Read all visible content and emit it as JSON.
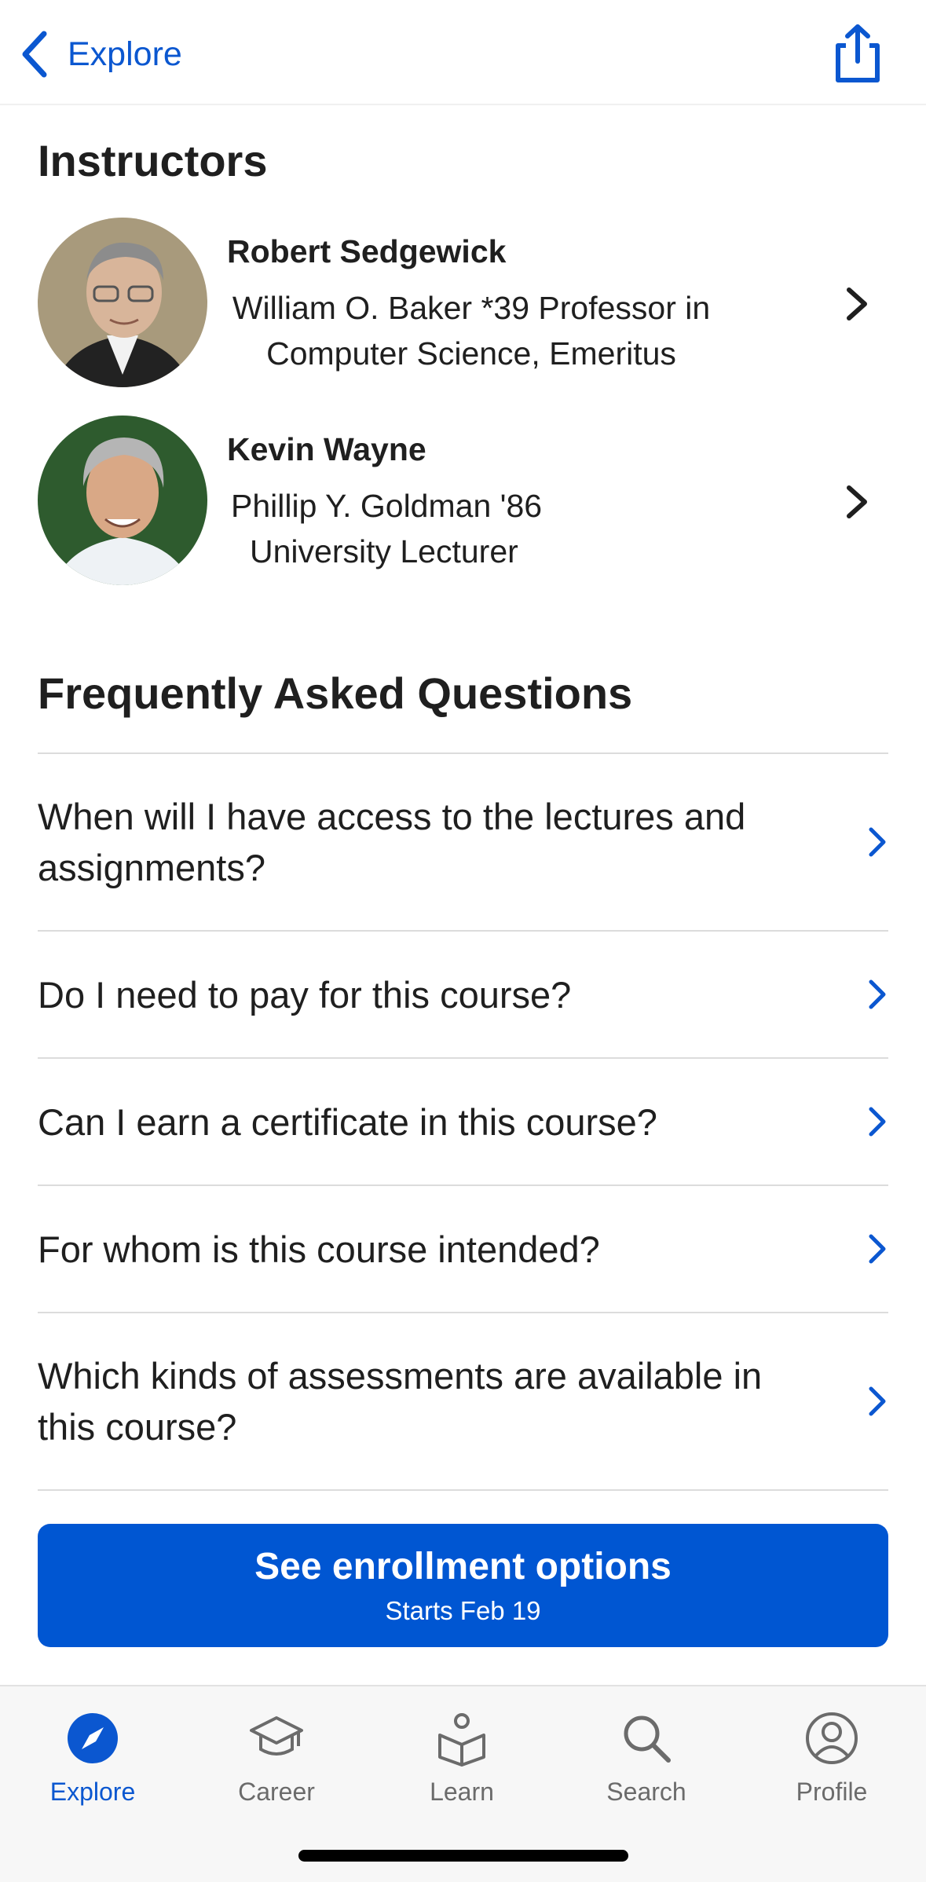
{
  "nav": {
    "back_label": "Explore",
    "icons": [
      "chevron-left-icon",
      "share-icon"
    ]
  },
  "instructors": {
    "heading": "Instructors",
    "items": [
      {
        "name": "Robert Sedgewick",
        "title_line1": "William O. Baker *39 Professor in",
        "title_line2": "Computer Science, Emeritus"
      },
      {
        "name": "Kevin Wayne",
        "title_line1": "Phillip Y. Goldman '86",
        "title_line2": "University Lecturer"
      }
    ]
  },
  "faq": {
    "heading": "Frequently Asked Questions",
    "items": [
      {
        "question": "When will I have access to the lectures and assignments?"
      },
      {
        "question": "Do I need to pay for this course?"
      },
      {
        "question": "Can I earn a certificate in this course?"
      },
      {
        "question": "For whom is this course intended?"
      },
      {
        "question": "Which kinds of assessments are available in this course?"
      }
    ]
  },
  "cta": {
    "label": "See enrollment options",
    "sublabel": "Starts Feb 19"
  },
  "tabbar": {
    "tabs": [
      {
        "label": "Explore",
        "icon": "compass-icon",
        "active": true
      },
      {
        "label": "Career",
        "icon": "graduation-cap-icon",
        "active": false
      },
      {
        "label": "Learn",
        "icon": "book-person-icon",
        "active": false
      },
      {
        "label": "Search",
        "icon": "search-icon",
        "active": false
      },
      {
        "label": "Profile",
        "icon": "profile-icon",
        "active": false
      }
    ]
  },
  "colors": {
    "accent": "#0b57d0",
    "cta": "#0056d2",
    "text": "#1f1f1f",
    "muted": "#6b6b6b",
    "divider": "#dcdcdc"
  }
}
